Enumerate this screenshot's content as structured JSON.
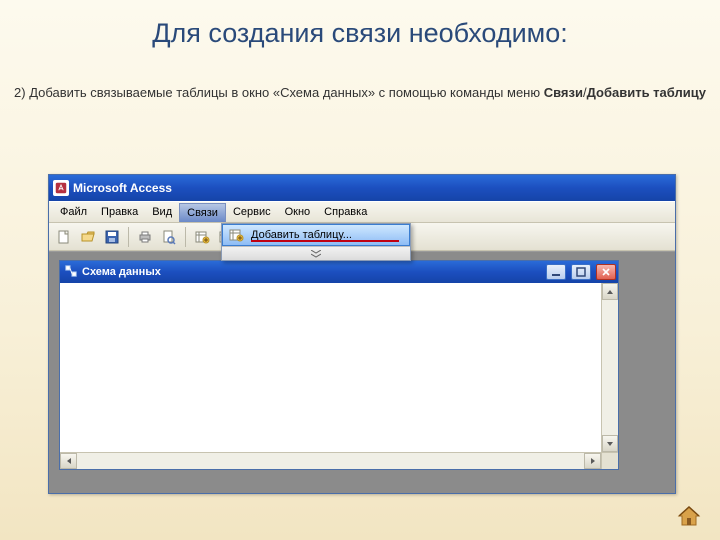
{
  "slide": {
    "heading": "Для создания связи необходимо:",
    "sub_pre": "2) Добавить связываемые таблицы в окно «Схема данных» с помощью команды меню ",
    "sub_bold1": "Связи",
    "sub_slash": "/",
    "sub_bold2": "Добавить таблицу"
  },
  "app": {
    "title": "Microsoft Access",
    "menu": {
      "file": "Файл",
      "edit": "Правка",
      "view": "Вид",
      "relations": "Связи",
      "service": "Сервис",
      "window": "Окно",
      "help": "Справка"
    },
    "dropdown": {
      "add_table": "Добавить таблицу..."
    },
    "child_title": "Схема данных"
  }
}
